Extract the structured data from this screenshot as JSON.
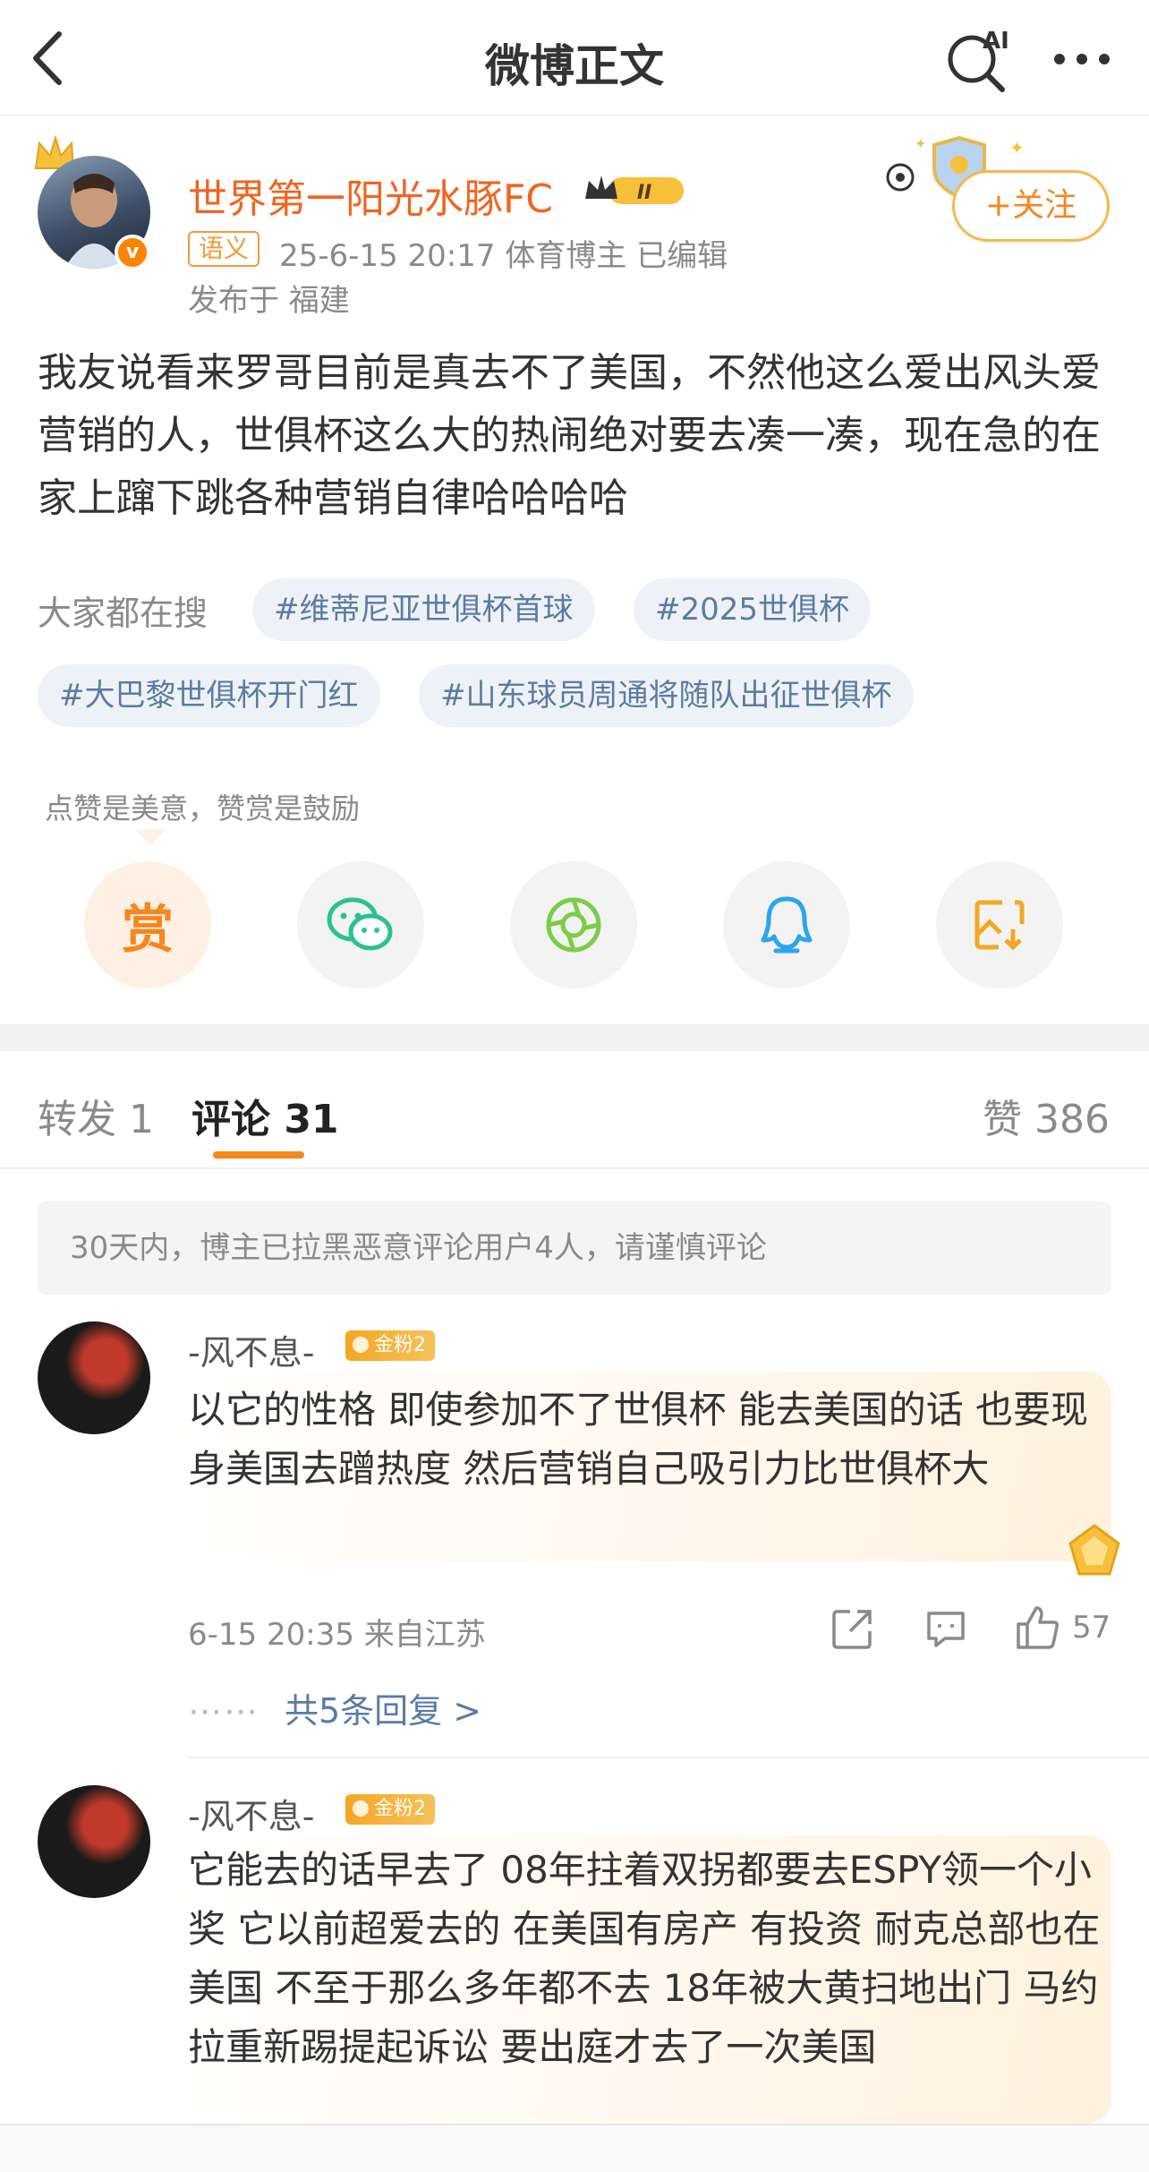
{
  "nav": {
    "title": "微博正文",
    "ai_label": "AI"
  },
  "post": {
    "username": "世界第一阳光水豚FC",
    "vip_level": "II",
    "semantic_tag": "语义",
    "meta": "25-6-15 20:17  体育博主  已编辑",
    "location": "发布于 福建",
    "follow_label": "+关注",
    "verified_mark": "v",
    "text": "我友说看来罗哥目前是真去不了美国，不然他这么爱出风头爱营销的人，世俱杯这么大的热闹绝对要去凑一凑，现在急的在家上蹿下跳各种营销自律哈哈哈哈"
  },
  "trending": {
    "label": "大家都在搜",
    "topics": [
      "#维蒂尼亚世俱杯首球",
      "#2025世俱杯",
      "#大巴黎世俱杯开门红",
      "#山东球员周通将随队出征世俱杯"
    ]
  },
  "reward": {
    "tip": "点赞是美意，赞赏是鼓励",
    "reward_char": "赏"
  },
  "tabs": {
    "repost": "转发 1",
    "comments": "评论 31",
    "likes": "赞 386"
  },
  "notice": "30天内，博主已拉黑恶意评论用户4人，请谨慎评论",
  "comments": [
    {
      "name": "-风不息-",
      "badge": "金粉2",
      "text": "以它的性格 即使参加不了世俱杯 能去美国的话 也要现身美国去蹭热度 然后营销自己吸引力比世俱杯大",
      "time": "6-15 20:35 来自江苏",
      "likes": "57",
      "replies_dots": "⋯⋯",
      "replies": "共5条回复 >"
    },
    {
      "name": "-风不息-",
      "badge": "金粉2",
      "text": "它能去的话早去了 08年拄着双拐都要去ESPY领一个小奖 它以前超爱去的 在美国有房产 有投资 耐克总部也在美国 不至于那么多年都不去 18年被大黄扫地出门 马约拉重新踢提起诉讼 要出庭才去了一次美国"
    }
  ],
  "colors": {
    "accent": "#f5871f",
    "username": "#f1641e",
    "topic_text": "#5b7ba5",
    "topic_bg": "#eef2f7",
    "muted": "#8a8a8a"
  },
  "icons": [
    "back-arrow-icon",
    "ai-search-icon",
    "more-icon",
    "crown-icon",
    "wechat-icon",
    "moments-icon",
    "qq-icon",
    "save-image-icon",
    "share-icon",
    "reply-icon",
    "like-icon",
    "gem-icon"
  ]
}
